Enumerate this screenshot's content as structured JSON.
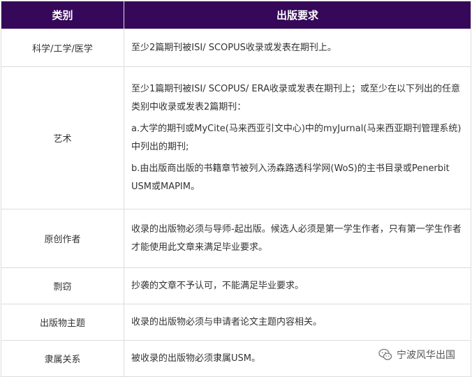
{
  "table": {
    "headers": [
      "类别",
      "出版要求"
    ],
    "rows": [
      {
        "category": "科学/工学/医学",
        "requirement": [
          "至少2篇期刊被ISI/ SCOPUS收录或发表在期刊上。"
        ]
      },
      {
        "category": "艺术",
        "requirement": [
          "至少1篇期刊被ISI/ SCOPUS/ ERA收录或发表在期刊上；或至少在以下列出的任意类别中收录或发表2篇期刊：",
          "a.大学的期刊或MyCite(马来西亚引文中心)中的myJurnal(马来西亚期刊管理系统)中列出的期刊;",
          "b.由出版商出版的书籍章节被列入汤森路透科学网(WoS)的主书目录或Penerbit USM或MAPIM。"
        ]
      },
      {
        "category": "原创作者",
        "requirement": [
          "收录的出版物必须与导师-起出版。候选人必须是第一学生作者，只有第一学生作者才能使用此文章来满足毕业要求。"
        ]
      },
      {
        "category": "剽窃",
        "requirement": [
          "抄袭的文章不予认可，不能满足毕业要求。"
        ]
      },
      {
        "category": "出版物主题",
        "requirement": [
          "收录的出版物必须与申请者论文主题内容相关。"
        ]
      },
      {
        "category": "隶属关系",
        "requirement": [
          "被收录的出版物必须隶属USM。"
        ]
      }
    ]
  },
  "watermark": {
    "text": "宁波风华出国",
    "icon": "wechat-icon"
  },
  "colors": {
    "header_bg": "#36085a",
    "header_text": "#ffffff",
    "border": "#dcdcdc",
    "body_text": "#333333"
  }
}
